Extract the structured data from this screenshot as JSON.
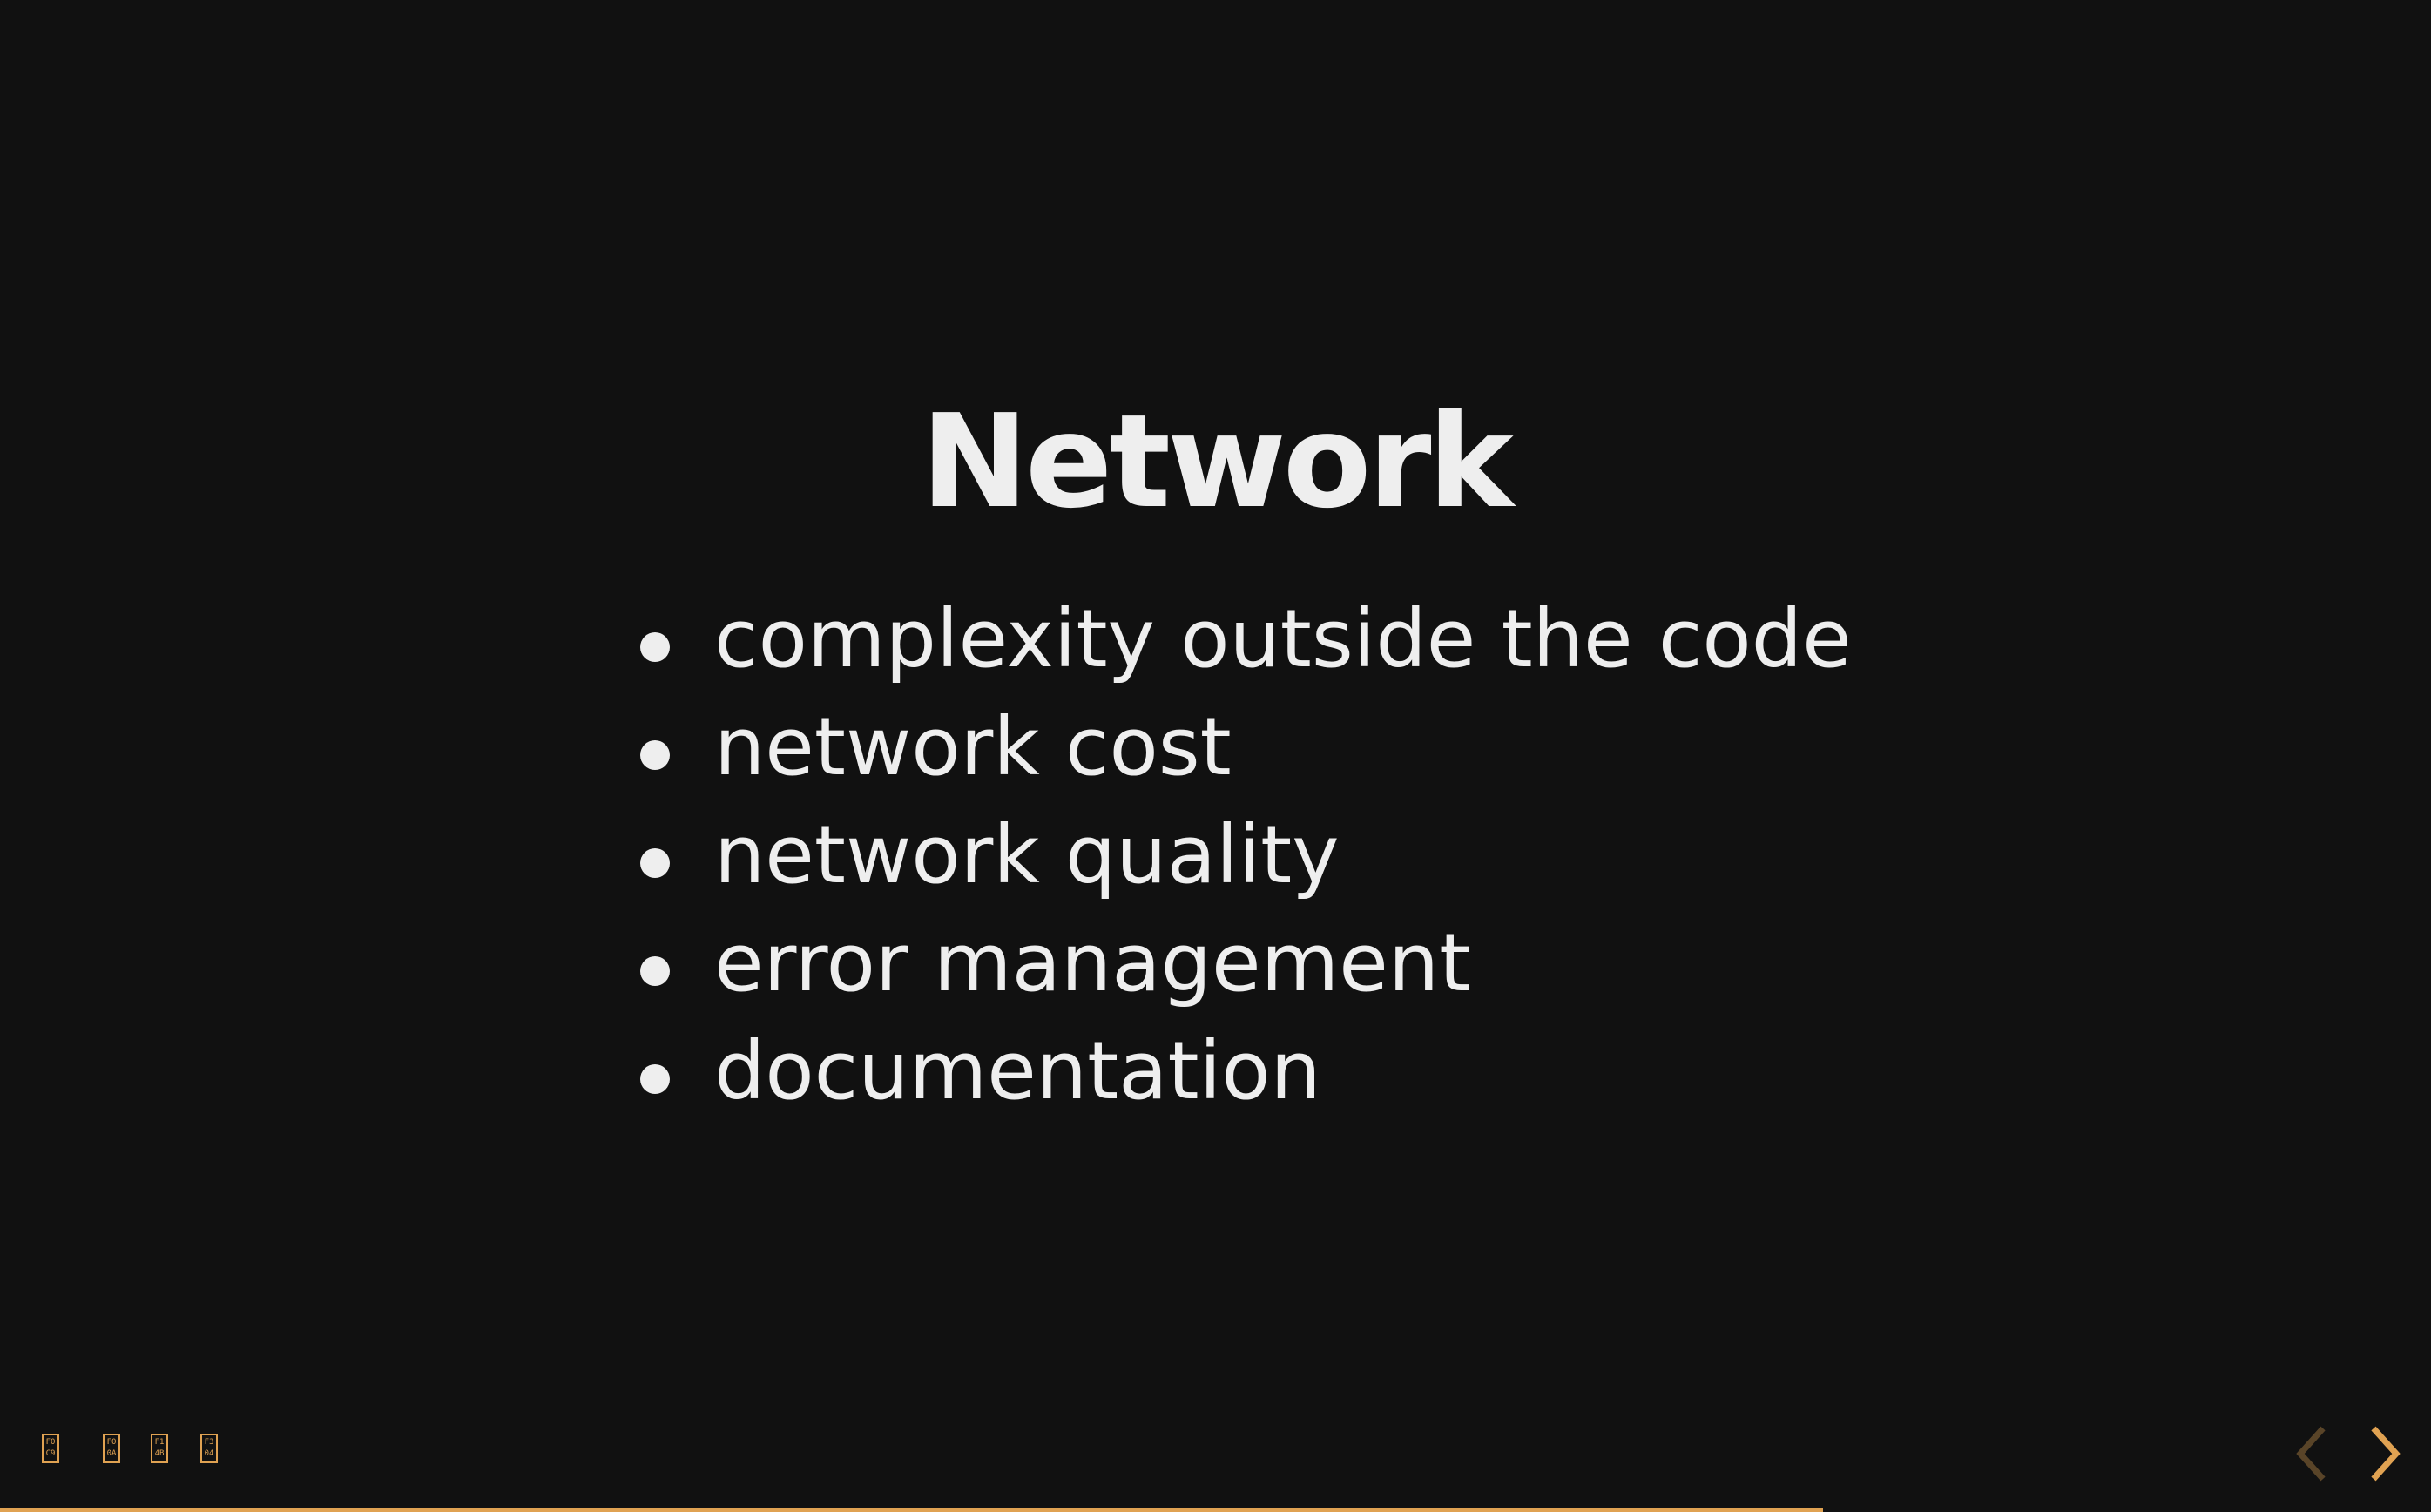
{
  "slide": {
    "title": "Network",
    "bullets": [
      "complexity outside the code",
      "network cost",
      "network quality",
      "error management",
      "documentation"
    ]
  },
  "missing_glyph_icons": [
    {
      "line1": "F0",
      "line2": "C9"
    },
    {
      "line1": "F0",
      "line2": "0A"
    },
    {
      "line1": "F1",
      "line2": "4B"
    },
    {
      "line1": "F3",
      "line2": "04"
    }
  ],
  "navigation": {
    "prev_icon": "chevron-left-icon",
    "next_icon": "chevron-right-icon",
    "prev_enabled": false,
    "next_enabled": true
  },
  "progress": {
    "fraction": 0.75
  },
  "colors": {
    "background": "#111111",
    "text": "#eeeeee",
    "accent": "#e0a252"
  }
}
